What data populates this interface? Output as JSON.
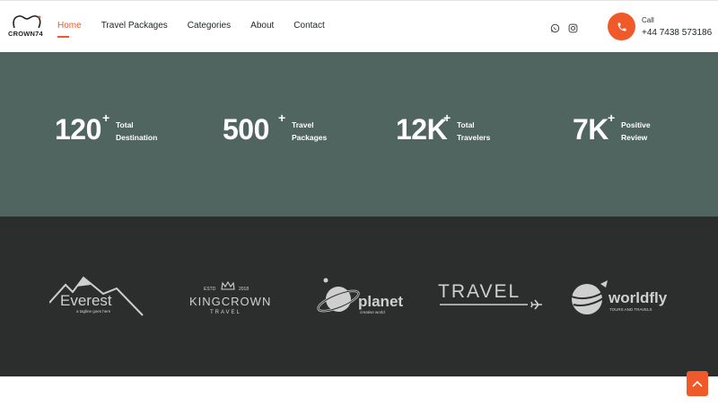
{
  "header": {
    "logo_text": "CROWN74",
    "nav": [
      {
        "label": "Home"
      },
      {
        "label": "Travel Packages"
      },
      {
        "label": "Categories"
      },
      {
        "label": "About"
      },
      {
        "label": "Contact"
      }
    ],
    "call_label": "Call",
    "phone": "+44 7438 573186",
    "accent_color": "#f05a2a"
  },
  "stats": [
    {
      "value": "120",
      "suffix": "+",
      "line1": "Total",
      "line2": "Destination"
    },
    {
      "value": "500",
      "suffix": "+",
      "line1": "Travel",
      "line2": "Packages"
    },
    {
      "value": "12K",
      "suffix": "+",
      "line1": "Total",
      "line2": "Travelers"
    },
    {
      "value": "7K",
      "suffix": "+",
      "line1": "Positive",
      "line2": "Review"
    }
  ],
  "partners": {
    "everest": {
      "name": "Everest",
      "tagline": "a tagline goes here"
    },
    "kingcrown": {
      "estd": "ESTD",
      "year": "2018",
      "name": "KINGCROWN",
      "sub": "TRAVEL"
    },
    "planet": {
      "name": "planet",
      "tagline": "creative world"
    },
    "travel": {
      "name": "TRAVEL"
    },
    "worldfly": {
      "name": "worldfly",
      "tagline": "TOURS AND TRAVELS"
    }
  },
  "icons": {
    "whatsapp": "whatsapp-icon",
    "instagram": "instagram-icon",
    "phone": "phone-icon",
    "scroll_top": "chevron-up-icon"
  }
}
